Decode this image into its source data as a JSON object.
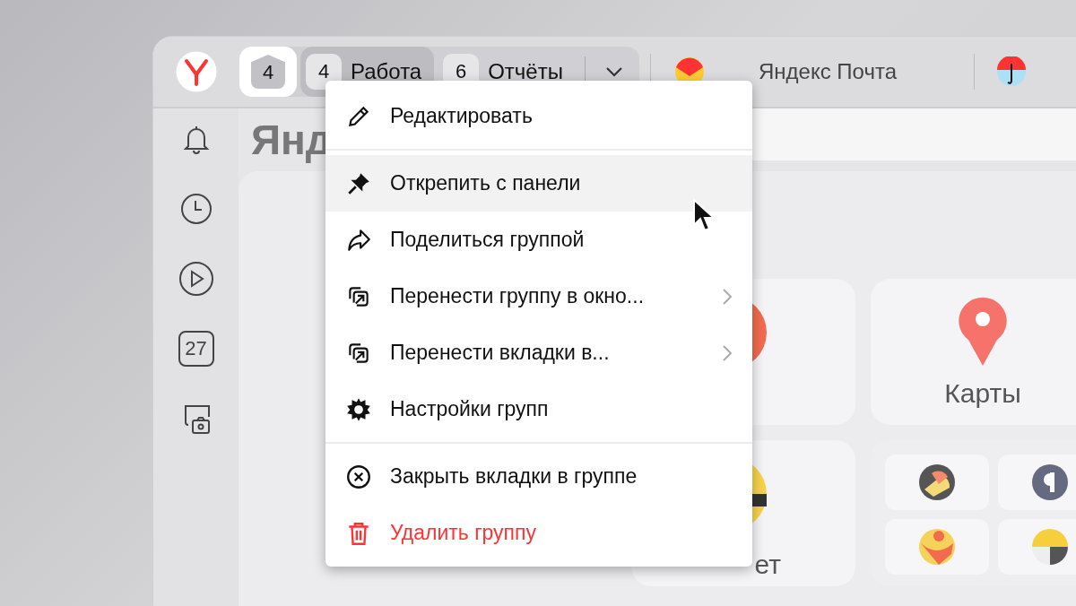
{
  "tab_bar": {
    "groups": [
      {
        "kind": "pinned",
        "count": "4",
        "selected": true,
        "menu_open": false
      },
      {
        "kind": "group",
        "count": "4",
        "label": "Работа",
        "selected": false,
        "menu_open": true
      },
      {
        "kind": "group",
        "count": "6",
        "label": "Отчёты",
        "selected": false,
        "menu_open": false
      }
    ],
    "tabs": [
      {
        "kind": "mail",
        "title": "Яндекс Почта"
      },
      {
        "kind": "umbrella"
      }
    ]
  },
  "sidebar": {
    "calendar_day": "27"
  },
  "page": {
    "heading": "Янд",
    "tiles": [
      {
        "kind": "orange"
      },
      {
        "kind": "pin",
        "label": "Карты"
      },
      {
        "kind": "striped",
        "label": "ет"
      },
      {
        "kind": "group"
      }
    ]
  },
  "context_menu": {
    "sections": [
      [
        {
          "label": "Редактировать",
          "hovered": false,
          "submenu": false,
          "danger": false
        }
      ],
      [
        {
          "label": "Открепить с панели",
          "hovered": true,
          "submenu": false,
          "danger": false
        },
        {
          "label": "Поделиться группой",
          "hovered": false,
          "submenu": false,
          "danger": false
        },
        {
          "label": "Перенести группу в окно...",
          "hovered": false,
          "submenu": true,
          "danger": false
        },
        {
          "label": "Перенести вкладки в...",
          "hovered": false,
          "submenu": true,
          "danger": false
        },
        {
          "label": "Настройки групп",
          "hovered": false,
          "submenu": false,
          "danger": false
        }
      ],
      [
        {
          "label": "Закрыть вкладки в группе",
          "hovered": false,
          "submenu": false,
          "danger": false
        },
        {
          "label": "Удалить группу",
          "hovered": false,
          "submenu": false,
          "danger": true
        }
      ]
    ]
  }
}
